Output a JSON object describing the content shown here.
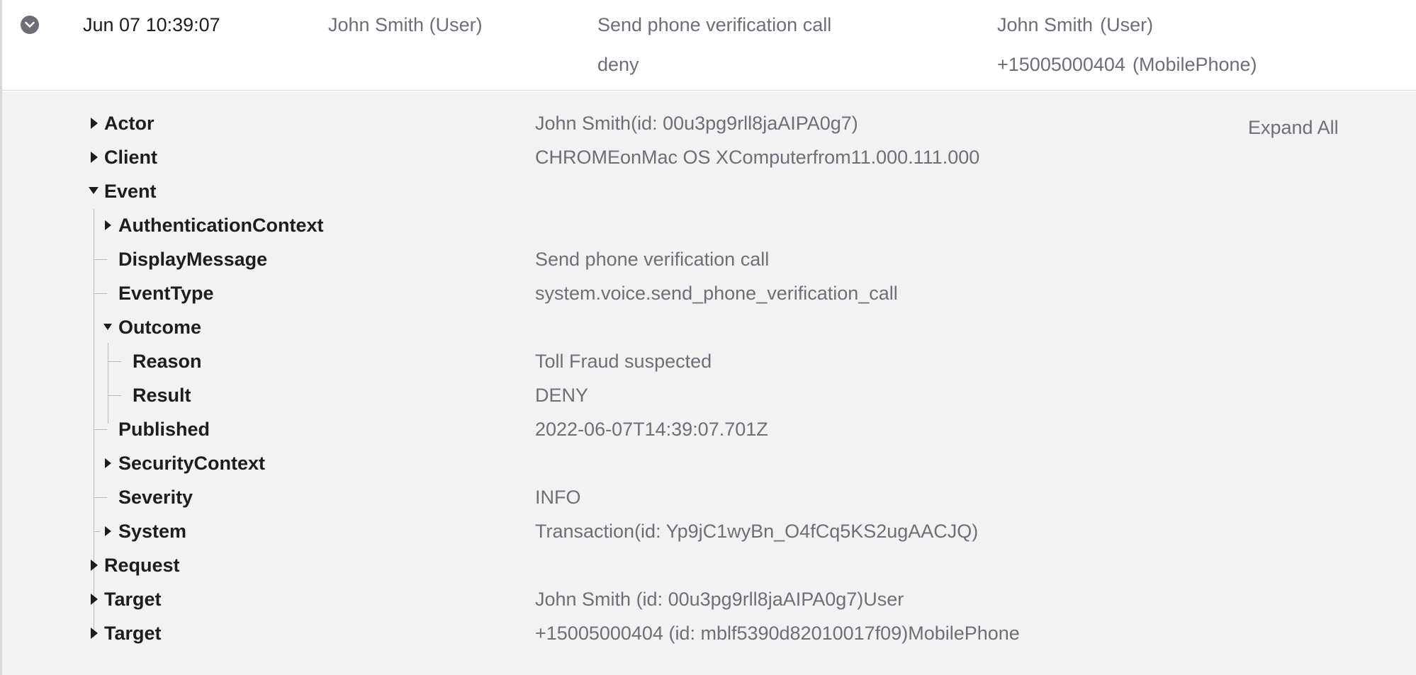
{
  "summary": {
    "time": "Jun 07 10:39:07",
    "actor_name": "John Smith",
    "actor_type": "(User)",
    "event": "Send phone verification call",
    "outcome": "deny",
    "target1_name": "John Smith",
    "target1_type": "(User)",
    "target2_name": "+15005000404",
    "target2_type": "(MobilePhone)"
  },
  "detail": {
    "expand_all_label": "Expand All",
    "rows": [
      {
        "key": "Actor",
        "value": "John Smith(id: 00u3pg9rll8jaAIPA0g7)"
      },
      {
        "key": "Client",
        "value": "CHROMEonMac OS XComputerfrom11.000.111.000"
      },
      {
        "key": "Event",
        "value": ""
      },
      {
        "key": "AuthenticationContext",
        "value": ""
      },
      {
        "key": "DisplayMessage",
        "value": "Send phone verification call"
      },
      {
        "key": "EventType",
        "value": "system.voice.send_phone_verification_call"
      },
      {
        "key": "Outcome",
        "value": ""
      },
      {
        "key": "Reason",
        "value": "Toll Fraud suspected"
      },
      {
        "key": "Result",
        "value": "DENY"
      },
      {
        "key": "Published",
        "value": "2022-06-07T14:39:07.701Z"
      },
      {
        "key": "SecurityContext",
        "value": ""
      },
      {
        "key": "Severity",
        "value": "INFO"
      },
      {
        "key": "System",
        "value": "Transaction(id: Yp9jC1wyBn_O4fCq5KS2ugAACJQ)"
      },
      {
        "key": "Request",
        "value": ""
      },
      {
        "key": "Target",
        "value": "John Smith (id: 00u3pg9rll8jaAIPA0g7)User"
      },
      {
        "key": "Target",
        "value": "+15005000404 (id: mblf5390d82010017f09)MobilePhone"
      }
    ]
  }
}
